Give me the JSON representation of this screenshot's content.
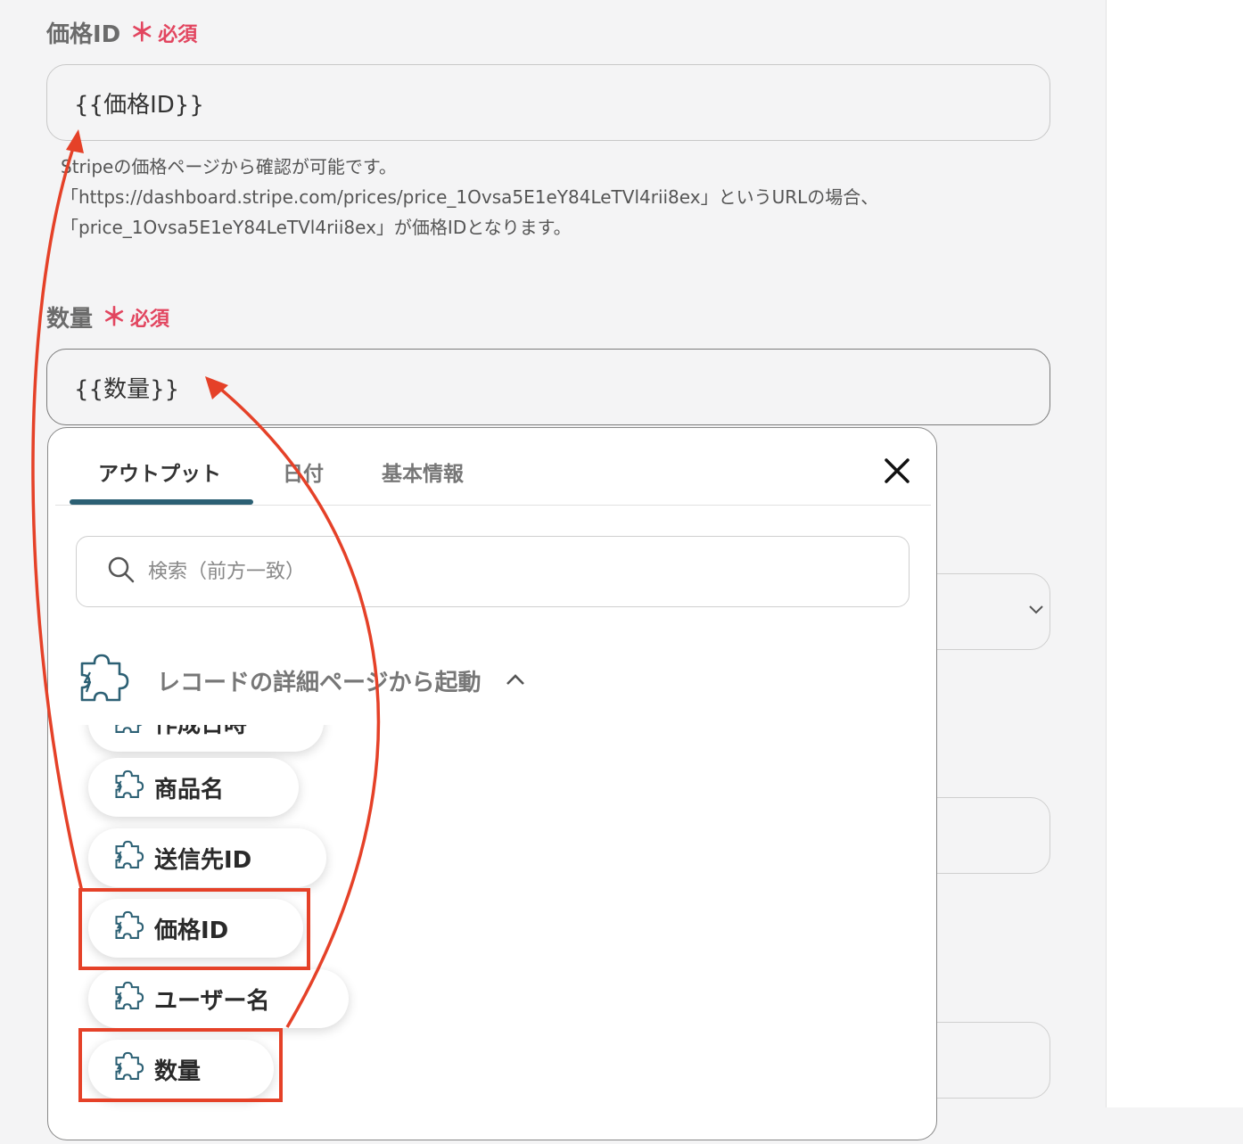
{
  "fields": {
    "price_id": {
      "label": "価格ID",
      "required": "必須",
      "value": "{{価格ID}}",
      "help_lines": [
        "Stripeの価格ページから確認が可能です。",
        "「https://dashboard.stripe.com/prices/price_1Ovsa5E1eY84LeTVl4rii8ex」というURLの場合、",
        "「price_1Ovsa5E1eY84LeTVl4rii8ex」が価格IDとなります。"
      ]
    },
    "quantity": {
      "label": "数量",
      "required": "必須",
      "value": "{{数量}}"
    }
  },
  "popup": {
    "tabs": [
      "アウトプット",
      "日付",
      "基本情報"
    ],
    "active_tab": "アウトプット",
    "search_placeholder": "検索（前方一致）",
    "group_title": "レコードの詳細ページから起動",
    "items": [
      "作成日時",
      "商品名",
      "送信先ID",
      "価格ID",
      "ユーザー名",
      "数量"
    ],
    "highlighted_items": [
      "価格ID",
      "数量"
    ]
  },
  "colors": {
    "required": "#e2455f",
    "accent_tab": "#2c6074",
    "annotation": "#e54128",
    "icon": "#2c6074"
  },
  "icons": [
    "search-icon",
    "close-icon",
    "puzzle-icon",
    "chevron-up-icon",
    "chevron-down-icon"
  ]
}
